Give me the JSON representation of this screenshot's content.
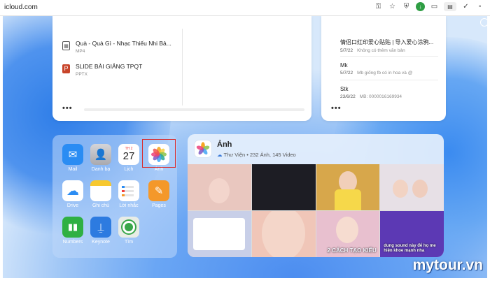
{
  "browser": {
    "url": "icloud.com"
  },
  "drive": {
    "files": [
      {
        "name": "Quà - Quà Gì - Nhạc Thiếu Nhi Bả...",
        "type": "MP4",
        "icon": "video-file-icon"
      },
      {
        "name": "SLIDE BÀI GIẢNG TPQT",
        "type": "PPTX",
        "icon": "pptx-file-icon"
      }
    ],
    "more": "•••"
  },
  "notes": {
    "items": [
      {
        "title": "情侣口红印爱心贴贴 | 导入爱心涂鸦...",
        "date": "5/7/22",
        "preview": "Không có thêm văn bản"
      },
      {
        "title": "Mk",
        "date": "5/7/22",
        "preview": "Mb giống fb có in hoa và @"
      },
      {
        "title": "Stk",
        "date": "23/6/22",
        "preview": "MB: 0000016169934"
      }
    ],
    "more": "•••"
  },
  "apps": [
    {
      "label": "Mail",
      "icon": "mail-icon",
      "color": "#2a8cf3"
    },
    {
      "label": "Danh bạ",
      "icon": "contacts-icon",
      "color": "#b9b9bd"
    },
    {
      "label": "Lịch",
      "icon": "calendar-icon",
      "color": "#ffffff",
      "weekday": "TH 2",
      "day": "27"
    },
    {
      "label": "Ảnh",
      "icon": "photos-icon",
      "color": "#ffffff"
    },
    {
      "label": "Drive",
      "icon": "cloud-icon",
      "color": "#2a8cf3"
    },
    {
      "label": "Ghi chú",
      "icon": "notes-icon",
      "color": "#ffffff"
    },
    {
      "label": "Lời nhắc",
      "icon": "reminders-icon",
      "color": "#ffffff"
    },
    {
      "label": "Pages",
      "icon": "pages-icon",
      "color": "#f4982a"
    },
    {
      "label": "Numbers",
      "icon": "numbers-icon",
      "color": "#2fb043"
    },
    {
      "label": "Keynote",
      "icon": "keynote-icon",
      "color": "#2d7be0"
    },
    {
      "label": "Tìm",
      "icon": "find-my-icon",
      "color": "#39a64a"
    }
  ],
  "photos": {
    "title": "Ảnh",
    "subtitle": "Thư Viện • 232 Ảnh, 145 Video",
    "tile_captions": [
      "",
      "",
      "",
      "",
      "",
      "",
      "2 CÁCH TẠO KIỂU",
      "dung sound này để họ me hiện khoe mạnh nha"
    ],
    "tile_colors": [
      "#e9c7bf",
      "#1d1d24",
      "#d7a74b",
      "#e7e0e6",
      "#c8cfe8",
      "#f0c6b8",
      "#e8c0cf",
      "#5c39b4"
    ]
  },
  "watermark": "mytour.vn"
}
